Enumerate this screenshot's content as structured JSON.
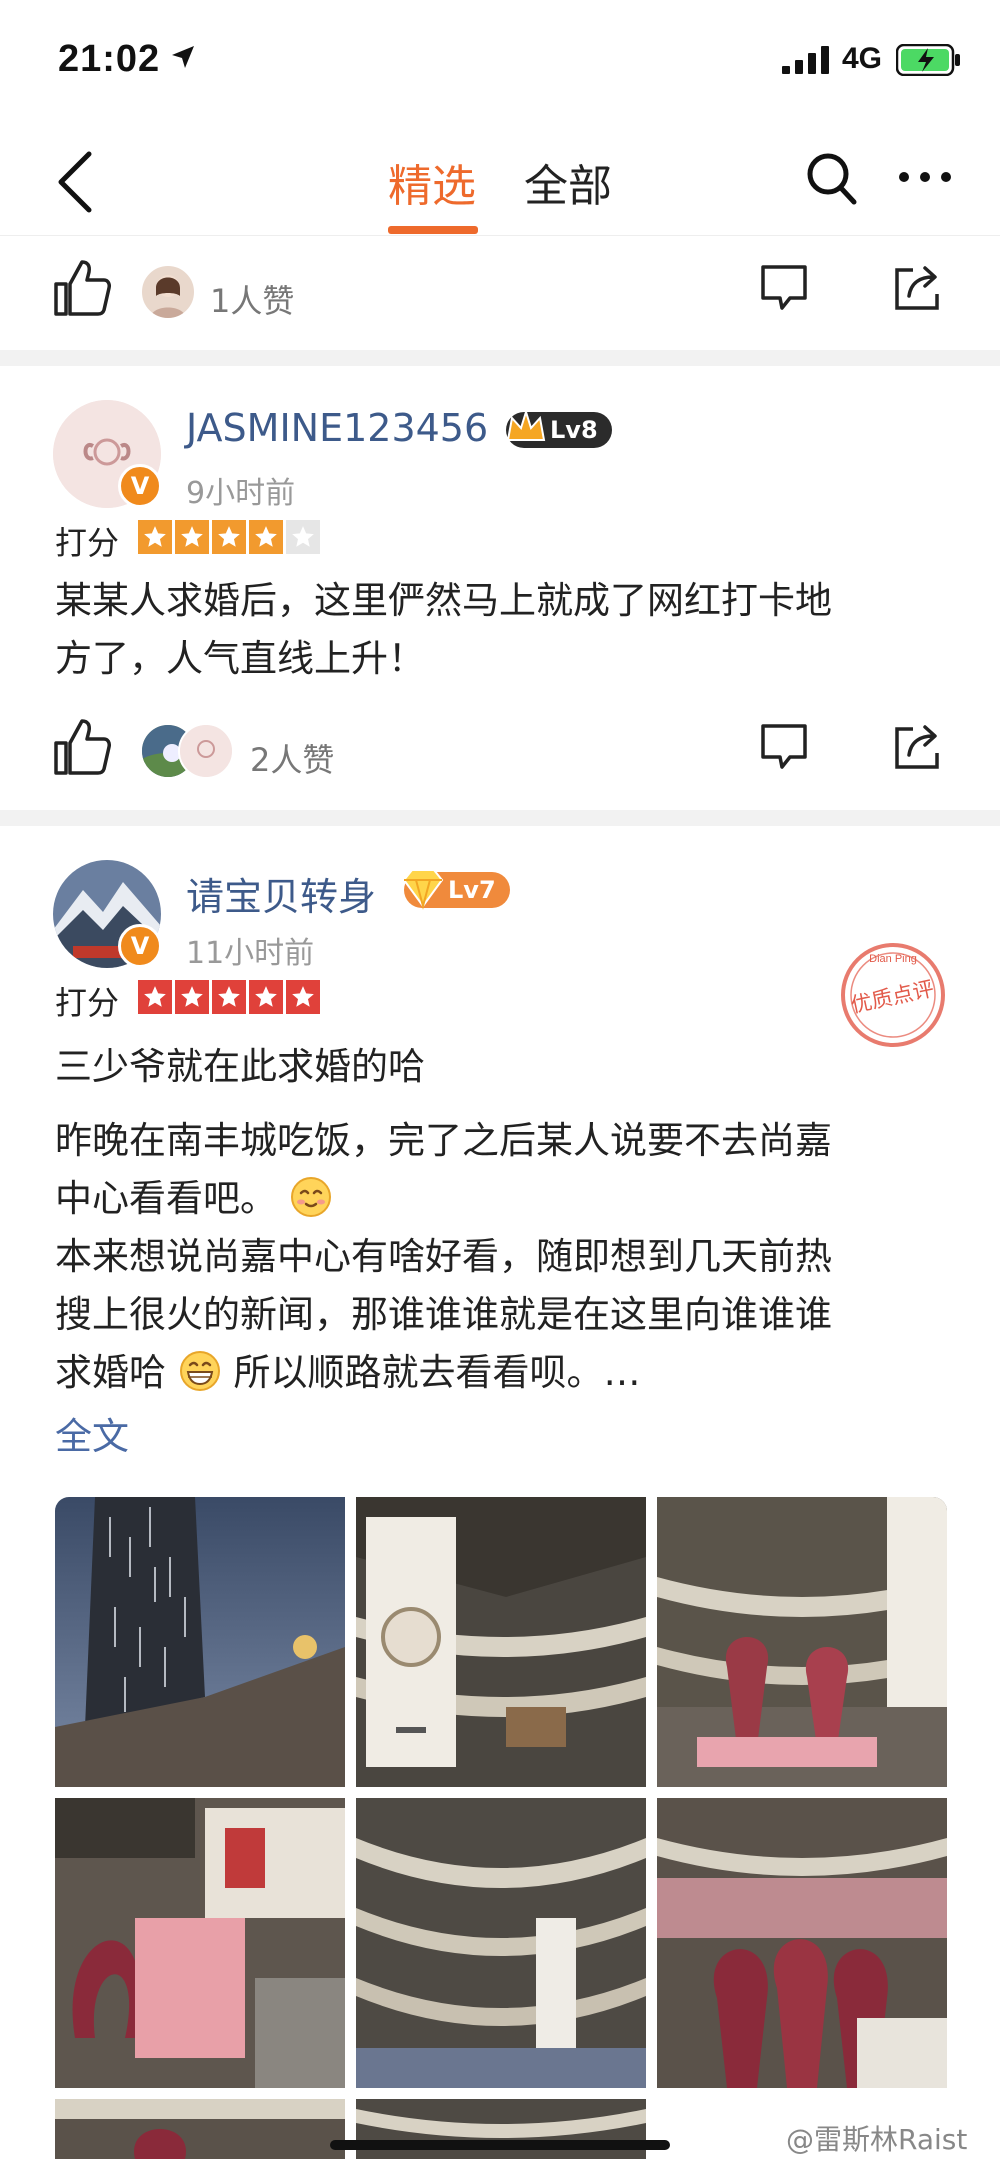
{
  "status": {
    "time": "21:02",
    "network": "4G"
  },
  "nav": {
    "tab_selected": "精选",
    "tab_all": "全部"
  },
  "top_action": {
    "likes": "1人赞"
  },
  "review1": {
    "username": "JASMINE123456",
    "level": "Lv8",
    "time_ago": "9小时前",
    "rating_label": "打分",
    "rating": 4,
    "content": [
      "某某人求婚后，这里俨然马上就成了网红打卡地",
      "方了，人气直线上升！"
    ],
    "likes": "2人赞"
  },
  "review2": {
    "username": "请宝贝转身",
    "level": "Lv7",
    "time_ago": "11小时前",
    "rating_label": "打分",
    "rating": 5,
    "stamp_text": "优质点评",
    "title": "三少爷就在此求婚的哈",
    "para1": [
      "昨晚在南丰城吃饭，完了之后某人说要不去尚嘉",
      "中心看看吧。"
    ],
    "para2": [
      "本来想说尚嘉中心有啥好看，随即想到几天前热",
      "搜上很火的新闻，那谁谁谁就是在这里向谁谁谁",
      "求婚哈",
      "所以顺路就去看看呗。…"
    ],
    "full_text": "全文"
  },
  "watermark": "@雷斯林Raist",
  "colors": {
    "accent": "#ee6a2c",
    "link": "#4a6aa5",
    "star_red": "#e0413a",
    "star_orange": "#f29a2e"
  }
}
